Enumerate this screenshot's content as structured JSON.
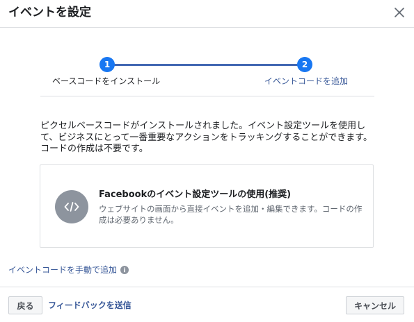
{
  "dialog": {
    "title": "イベントを設定"
  },
  "stepper": {
    "steps": [
      {
        "number": "1",
        "label": "ベースコードをインストール"
      },
      {
        "number": "2",
        "label": "イベントコードを追加"
      }
    ],
    "active_color": "#1877f2",
    "track_color": "#4267b2"
  },
  "description": "ピクセルベースコードがインストールされました。イベント設定ツールを使用して、ビジネスにとって一番重要なアクションをトラッキングすることができます。コードの作成は不要です。",
  "option_card": {
    "icon": "code-icon",
    "title": "Facebookのイベント設定ツールの使用(推奨)",
    "subtitle": "ウェブサイトの画面から直接イベントを追加・編集できます。コードの作成は必要ありません。"
  },
  "manual_link": {
    "label": "イベントコードを手動で追加",
    "icon": "info-icon"
  },
  "footer": {
    "back_label": "戻る",
    "feedback_label": "フィードバックを送信",
    "cancel_label": "キャンセル"
  },
  "colors": {
    "link": "#385898",
    "border": "#dddfe2",
    "icon_bg": "#8d949e"
  }
}
